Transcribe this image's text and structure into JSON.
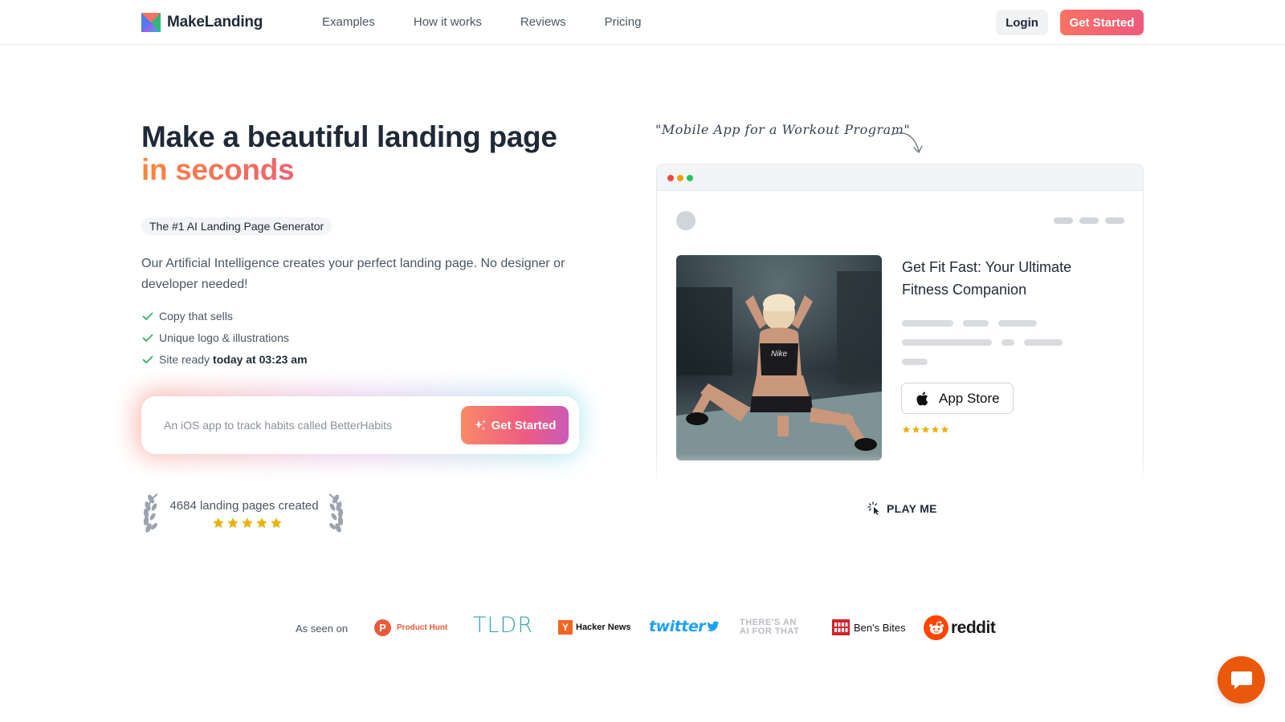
{
  "nav": {
    "brand": "MakeLanding",
    "links": [
      "Examples",
      "How it works",
      "Reviews",
      "Pricing"
    ],
    "login": "Login",
    "cta": "Get Started"
  },
  "hero": {
    "title_line1": "Make a beautiful landing page",
    "title_line2": "in seconds",
    "badge": "The #1 AI Landing Page Generator",
    "description": "Our Artificial Intelligence creates your perfect landing page. No designer or developer needed!",
    "features": [
      {
        "text": "Copy that sells",
        "bold": ""
      },
      {
        "text": "Unique logo & illustrations",
        "bold": ""
      },
      {
        "text": "Site ready",
        "bold": "today at 03:23 am"
      }
    ],
    "input_placeholder": "An iOS app to track habits called BetterHabits",
    "input_value": "",
    "cta": "Get Started",
    "created_text": "4684 landing pages created",
    "created_rating": 5
  },
  "preview": {
    "handnote": "\"Mobile App for a Workout Program\"",
    "mock_title": "Get Fit Fast: Your Ultimate Fitness Companion",
    "appstore_label": "App Store",
    "mock_rating": 5,
    "play_label": "PLAY ME"
  },
  "seen_on": {
    "label": "As seen on",
    "logos": {
      "producthunt": "Product Hunt",
      "producthunt_letter": "P",
      "tldr": "TLDR",
      "hackernews": "Hacker News",
      "hackernews_letter": "Y",
      "twitter": "twitter",
      "aift_line1": "THERE'S AN",
      "aift_line2": "AI FOR THAT",
      "bensbites": "Ben's Bites",
      "reddit": "reddit"
    }
  },
  "colors": {
    "brand_gradient_start": "#f97362",
    "brand_gradient_end": "#ee5a7d",
    "check_green": "#22a35a",
    "star_gold": "#eab308",
    "chat_orange": "#ea580c"
  },
  "icons": {
    "feature": "check-icon",
    "prompt_button": "sparkles-icon",
    "play": "cursor-click-icon",
    "appstore": "apple-icon",
    "chat": "chat-bubble-icon"
  }
}
